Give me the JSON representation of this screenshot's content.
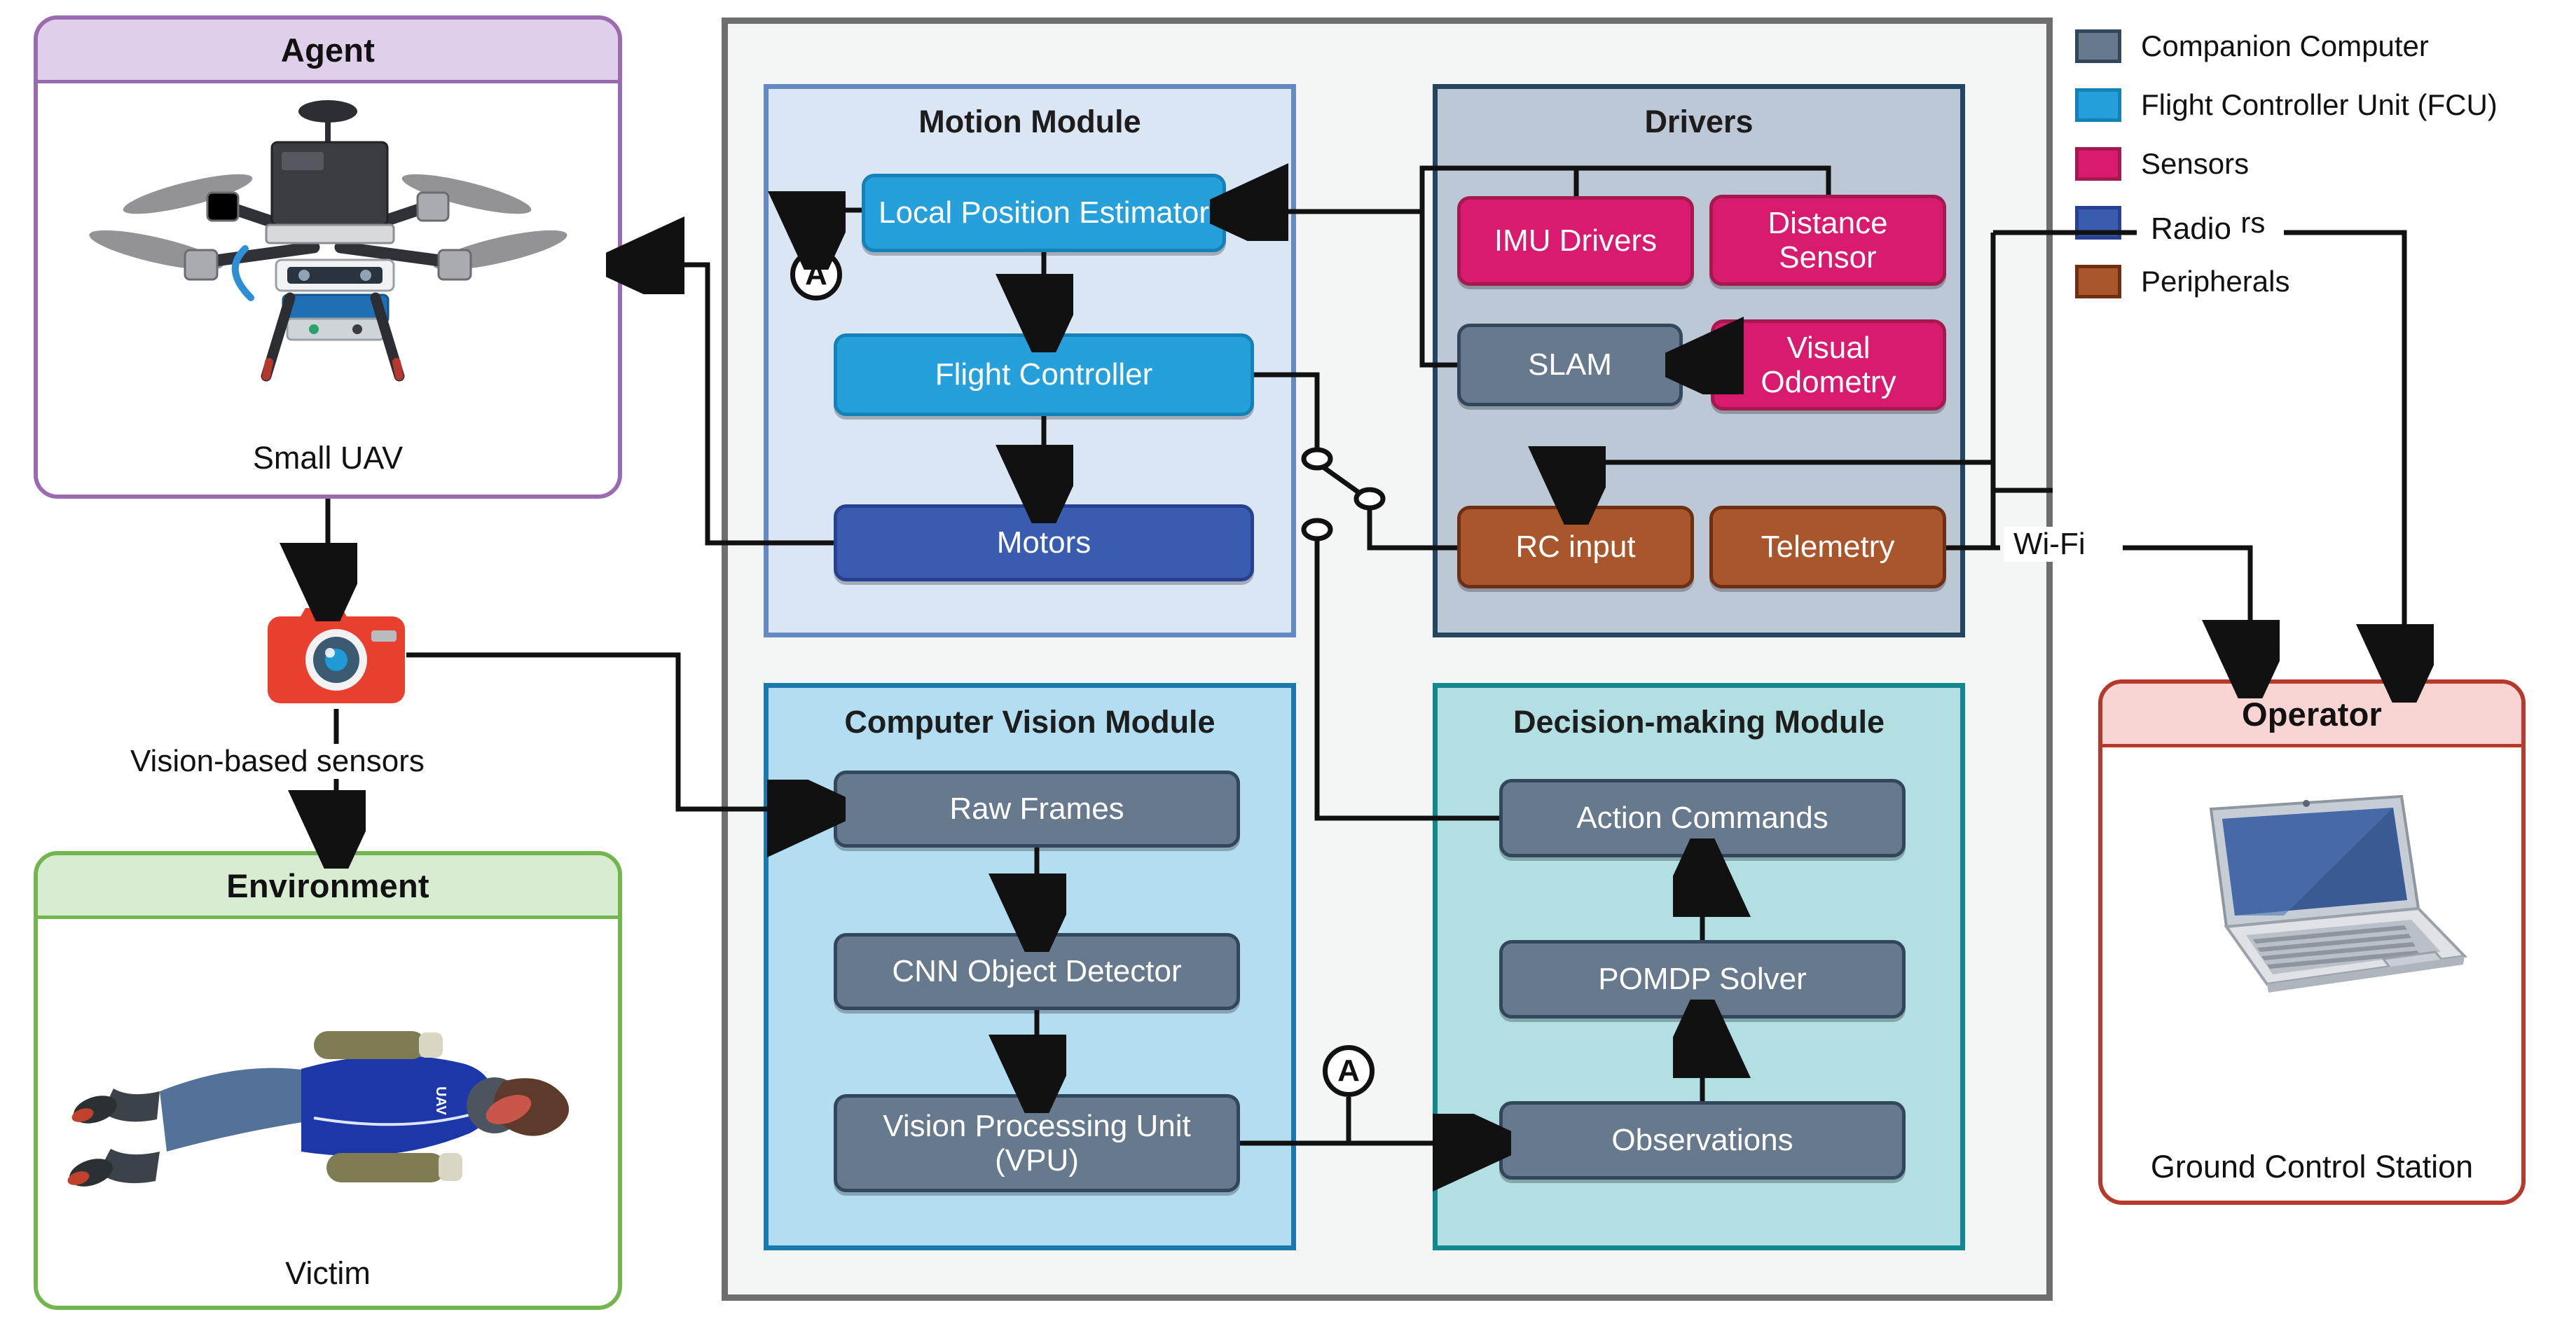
{
  "agent": {
    "title": "Agent",
    "caption": "Small UAV",
    "image_name": "uav-photo"
  },
  "environment": {
    "title": "Environment",
    "caption": "Victim",
    "image_name": "victim-photo"
  },
  "operator": {
    "title": "Operator",
    "caption": "Ground Control Station",
    "image_name": "laptop-photo"
  },
  "sensor_link": {
    "icon_name": "camera-icon",
    "label": "Vision-based sensors"
  },
  "links": {
    "radio": "Radio",
    "wifi": "Wi-Fi",
    "connector_a": "A"
  },
  "modules": [
    {
      "id": "motion",
      "title": "Motion Module",
      "nodes": [
        {
          "label": "Local Position Estimator",
          "kind": "fcu"
        },
        {
          "label": "Flight Controller",
          "kind": "fcu"
        },
        {
          "label": "Motors",
          "kind": "actuator"
        }
      ]
    },
    {
      "id": "drivers",
      "title": "Drivers",
      "nodes": [
        {
          "label": "IMU Drivers",
          "kind": "sensor"
        },
        {
          "label": "Distance Sensor",
          "kind": "sensor"
        },
        {
          "label": "SLAM",
          "kind": "companion"
        },
        {
          "label": "Visual Odometry",
          "kind": "sensor"
        },
        {
          "label": "RC input",
          "kind": "peripheral"
        },
        {
          "label": "Telemetry",
          "kind": "peripheral"
        }
      ]
    },
    {
      "id": "vision",
      "title": "Computer Vision Module",
      "nodes": [
        {
          "label": "Raw Frames",
          "kind": "companion"
        },
        {
          "label": "CNN Object Detector",
          "kind": "companion"
        },
        {
          "label": "Vision Processing Unit (VPU)",
          "kind": "companion"
        }
      ]
    },
    {
      "id": "decision",
      "title": "Decision-making Module",
      "nodes": [
        {
          "label": "Action Commands",
          "kind": "companion"
        },
        {
          "label": "POMDP Solver",
          "kind": "companion"
        },
        {
          "label": "Observations",
          "kind": "companion"
        }
      ]
    }
  ],
  "legend": {
    "items": [
      {
        "label": "Companion Computer",
        "fill": "#66798d",
        "stroke": "#32475b"
      },
      {
        "label": "Flight Controller Unit (FCU)",
        "fill": "#25a0db",
        "stroke": "#1581b9"
      },
      {
        "label": "Sensors",
        "fill": "#d81b6e",
        "stroke": "#a5194f"
      },
      {
        "label": "Actuators",
        "fill": "#3a5cb0",
        "stroke": "#27408f"
      },
      {
        "label": "Peripherals",
        "fill": "#a9562c",
        "stroke": "#6f2f13"
      }
    ]
  }
}
